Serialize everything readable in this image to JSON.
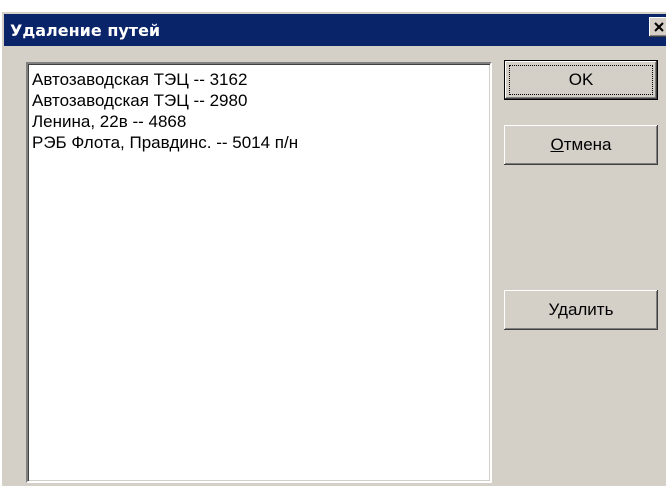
{
  "dialog": {
    "title": "Удаление путей"
  },
  "list": {
    "items": [
      "Автозаводская ТЭЦ -- 3162",
      "Автозаводская ТЭЦ -- 2980",
      "Ленина, 22в -- 4868",
      "РЭБ Флота, Правдинс. -- 5014 п/н"
    ]
  },
  "buttons": {
    "ok_label": "OK",
    "cancel_first": "О",
    "cancel_rest": "тмена",
    "delete_label": "Удалить"
  },
  "icons": {
    "close": "close-icon"
  }
}
